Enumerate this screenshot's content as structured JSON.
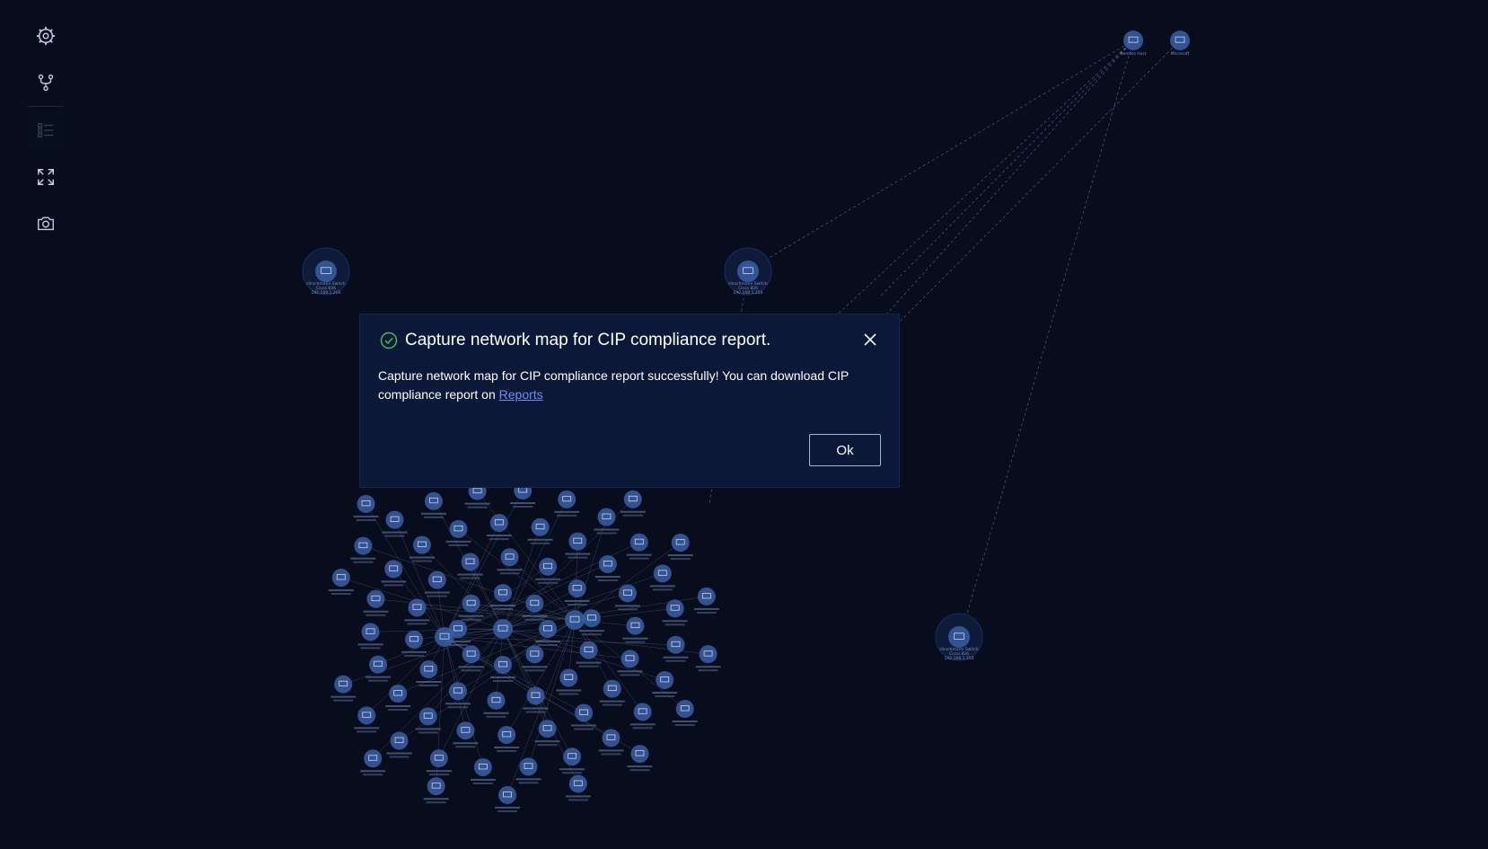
{
  "toolbar": {
    "items": [
      {
        "name": "settings-icon",
        "enabled": true
      },
      {
        "name": "topology-icon",
        "enabled": true
      },
      {
        "name": "list-view-icon",
        "enabled": false
      },
      {
        "name": "fit-screen-icon",
        "enabled": true
      },
      {
        "name": "camera-icon",
        "enabled": true
      }
    ]
  },
  "network_map": {
    "top_nodes": [
      {
        "label": "Remote Host"
      },
      {
        "label": "Microsoft"
      }
    ],
    "switches": [
      {
        "line1": "Hirschmann Switch",
        "line2": "Cisco 836",
        "line3": "192.168.1.200"
      },
      {
        "line1": "Hirschmann Switch",
        "line2": "Cisco 826",
        "line3": "192.168.1.250"
      },
      {
        "line1": "Hirschmann Switch",
        "line2": "Cisco 826",
        "line3": "192.168.1.254"
      }
    ],
    "colors": {
      "node_fill": "#3a5fa6",
      "node_ring": "#1a3063",
      "edge": "#6f7f9f",
      "background": "#070d1c"
    }
  },
  "dialog": {
    "title": "Capture network map for CIP compliance report.",
    "message": "Capture network map for CIP compliance report successfully! You can download CIP compliance report on ",
    "link_text": "Reports",
    "ok_label": "Ok",
    "success_color": "#3fbf5a"
  }
}
